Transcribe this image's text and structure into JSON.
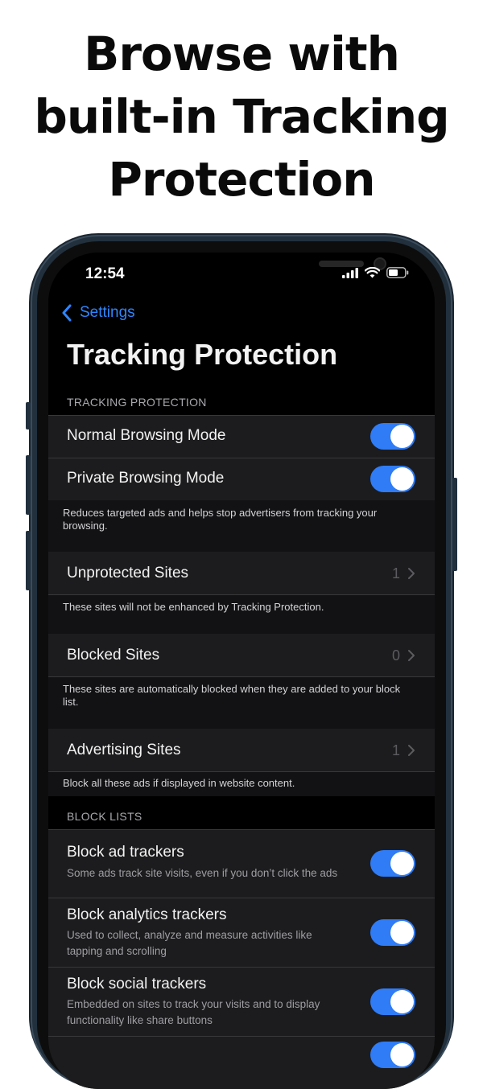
{
  "headline": {
    "line1": "Browse with",
    "line2": "built-in Tracking",
    "line3": "Protection"
  },
  "status_bar": {
    "time": "12:54"
  },
  "nav": {
    "back_label": "Settings",
    "title": "Tracking Protection"
  },
  "sections": {
    "tracking_header": "TRACKING PROTECTION",
    "normal_mode": {
      "label": "Normal Browsing Mode",
      "enabled": true
    },
    "private_mode": {
      "label": "Private Browsing Mode",
      "enabled": true
    },
    "mode_footer": "Reduces targeted ads and helps stop advertisers from tracking your browsing.",
    "unprotected": {
      "label": "Unprotected Sites",
      "count": "1",
      "footer": "These sites will not be enhanced by Tracking Protection."
    },
    "blocked": {
      "label": "Blocked Sites",
      "count": "0",
      "footer": "These sites are automatically blocked when they are added to your block list."
    },
    "advertising": {
      "label": "Advertising Sites",
      "count": "1",
      "footer": "Block all these ads if displayed in website content."
    },
    "block_lists_header": "BLOCK LISTS",
    "ad_trackers": {
      "label": "Block ad trackers",
      "sub": "Some ads track site visits, even if you don’t click the ads",
      "enabled": true
    },
    "analytics_trackers": {
      "label": "Block analytics trackers",
      "sub": "Used to collect, analyze and measure activities like tapping and scrolling",
      "enabled": true
    },
    "social_trackers": {
      "label": "Block social trackers",
      "sub": "Embedded on sites to track your visits and to display functionality like share buttons",
      "enabled": true
    }
  },
  "colors": {
    "accent": "#2f86ff",
    "toggle_on": "#2f7cf6",
    "cell_bg": "#1c1c1e",
    "screen_bg": "#000000"
  }
}
